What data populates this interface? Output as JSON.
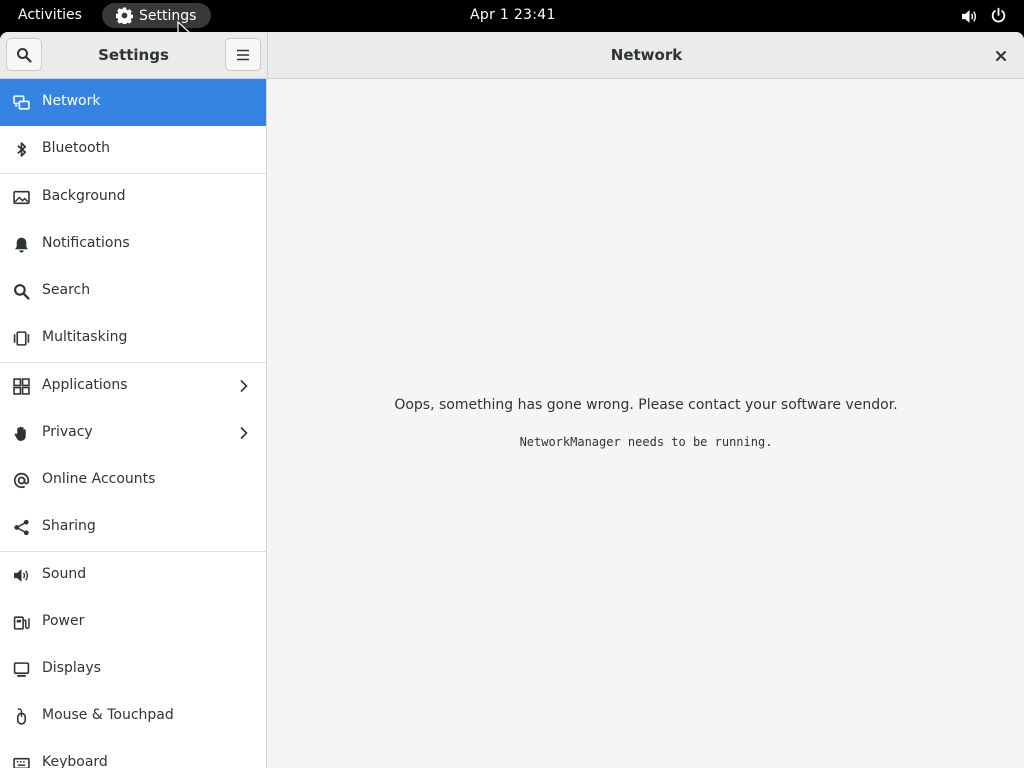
{
  "topbar": {
    "activities": "Activities",
    "app_name": "Settings",
    "clock": "Apr 1  23:41"
  },
  "window": {
    "sidebar_title": "Settings",
    "main_title": "Network"
  },
  "sidebar": {
    "items": [
      {
        "label": "Network",
        "icon": "network-icon"
      },
      {
        "label": "Bluetooth",
        "icon": "bluetooth-icon"
      },
      {
        "label": "Background",
        "icon": "background-icon"
      },
      {
        "label": "Notifications",
        "icon": "bell-icon"
      },
      {
        "label": "Search",
        "icon": "search-icon"
      },
      {
        "label": "Multitasking",
        "icon": "multitasking-icon"
      },
      {
        "label": "Applications",
        "icon": "applications-icon"
      },
      {
        "label": "Privacy",
        "icon": "hand-icon"
      },
      {
        "label": "Online Accounts",
        "icon": "at-icon"
      },
      {
        "label": "Sharing",
        "icon": "share-icon"
      },
      {
        "label": "Sound",
        "icon": "speaker-icon"
      },
      {
        "label": "Power",
        "icon": "power-plug-icon"
      },
      {
        "label": "Displays",
        "icon": "display-icon"
      },
      {
        "label": "Mouse & Touchpad",
        "icon": "mouse-icon"
      },
      {
        "label": "Keyboard",
        "icon": "keyboard-icon"
      }
    ]
  },
  "main": {
    "error_message": "Oops, something has gone wrong. Please contact your software vendor.",
    "error_detail": "NetworkManager needs to be running."
  },
  "colors": {
    "accent": "#3584e4",
    "topbar": "#000000",
    "window_bg": "#f6f5f4"
  }
}
